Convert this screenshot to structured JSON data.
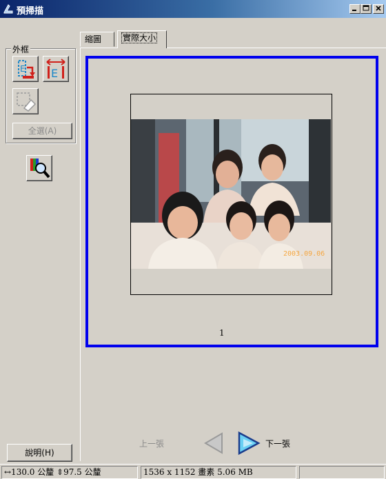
{
  "window": {
    "title": "預掃描",
    "controls": [
      "minimize",
      "maximize",
      "close"
    ]
  },
  "frame_group": {
    "legend": "外框",
    "select_all_label": "全選(A)"
  },
  "tabs": [
    {
      "label": "縮圖",
      "active": false
    },
    {
      "label": "實際大小",
      "active": true
    }
  ],
  "preview": {
    "page_number": "1",
    "photo_date_stamp": "2003.09.06"
  },
  "navigation": {
    "prev_label": "上一張",
    "next_label": "下一張",
    "prev_enabled": false,
    "next_enabled": true
  },
  "help_button_label": "說明(H)",
  "status": {
    "dimensions": "↔130.0 公釐 ⇕97.5 公釐",
    "resolution_info": "1536 x 1152 畫素 5.06 MB",
    "extra": ""
  },
  "colors": {
    "title_bar_start": "#0a246a",
    "title_bar_end": "#a6caf0",
    "preview_border": "#0000ee",
    "face": "#d4d0c8"
  }
}
